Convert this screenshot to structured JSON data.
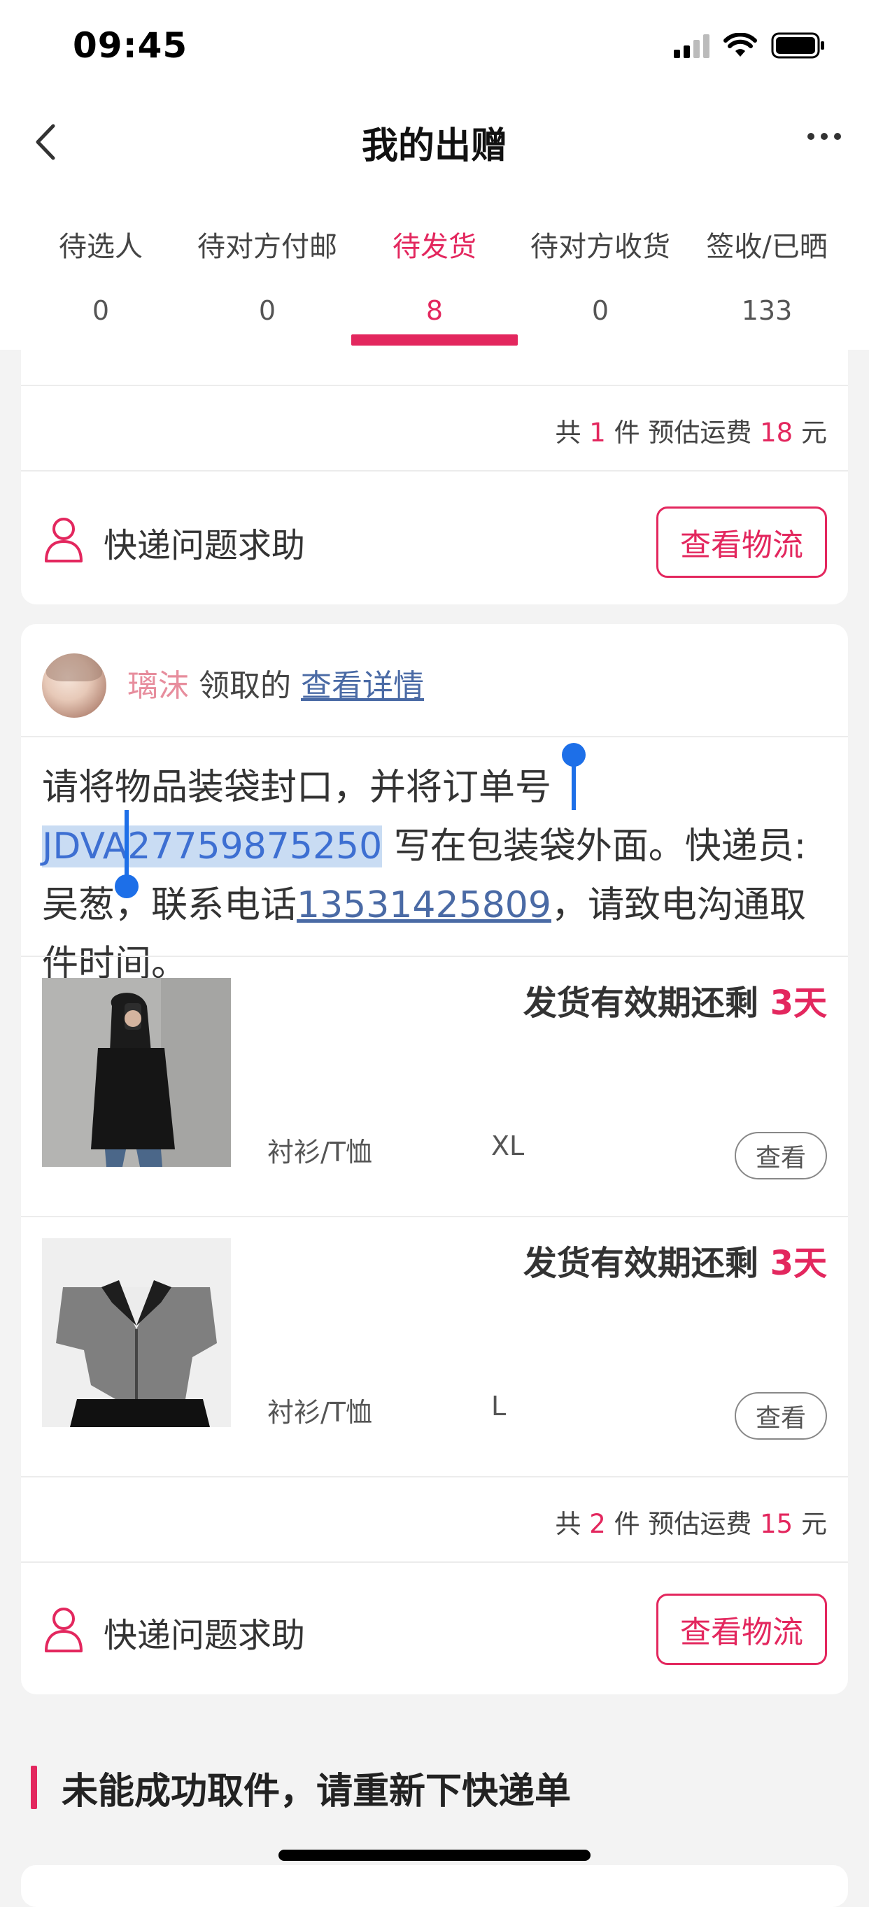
{
  "status_bar": {
    "time": "09:45"
  },
  "nav": {
    "title": "我的出赠"
  },
  "tabs": [
    {
      "label": "待选人",
      "count": "0"
    },
    {
      "label": "待对方付邮",
      "count": "0"
    },
    {
      "label": "待发货",
      "count": "8",
      "active": true
    },
    {
      "label": "待对方收货",
      "count": "0"
    },
    {
      "label": "签收/已晒",
      "count": "133"
    }
  ],
  "card1": {
    "summary": {
      "prefix": "共",
      "count": "1",
      "unit": "件 预估运费",
      "fee": "18",
      "currency": "元"
    },
    "help_label": "快递问题求助",
    "logistics_button": "查看物流"
  },
  "card2": {
    "claimer": "璃沫",
    "claim_suffix": "领取的",
    "detail_link": "查看详情",
    "instruction": {
      "part1": "请将物品装袋封口，并将订单号",
      "order_no": "JDVA27759875250",
      "part2": "写在包装袋外面。快递员:吴葱，联系电话",
      "phone": "13531425809",
      "part3": "，请致电沟通取件时间。"
    },
    "items": [
      {
        "deadline_prefix": "发货有效期还剩",
        "deadline_days": "3天",
        "category": "衬衫/T恤",
        "size": "XL",
        "view_label": "查看"
      },
      {
        "deadline_prefix": "发货有效期还剩",
        "deadline_days": "3天",
        "category": "衬衫/T恤",
        "size": "L",
        "view_label": "查看"
      }
    ],
    "summary": {
      "prefix": "共",
      "count": "2",
      "unit": "件 预估运费",
      "fee": "15",
      "currency": "元"
    },
    "help_label": "快递问题求助",
    "logistics_button": "查看物流"
  },
  "section_title": "未能成功取件，请重新下快递单",
  "colors": {
    "accent": "#e3275e",
    "link": "#4a6aa5",
    "selection": "#c9dcf3"
  }
}
